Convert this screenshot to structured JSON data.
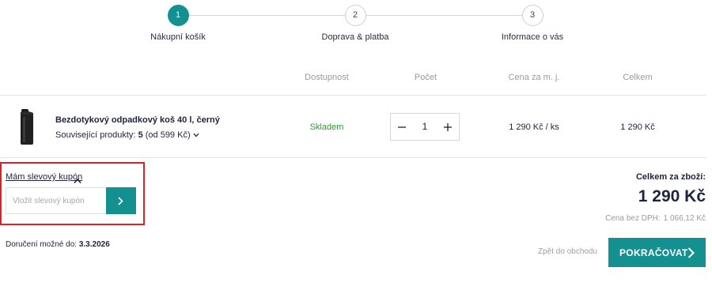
{
  "stepper": {
    "steps": [
      {
        "number": "1",
        "label": "Nákupní košík"
      },
      {
        "number": "2",
        "label": "Doprava & platba"
      },
      {
        "number": "3",
        "label": "Informace o vás"
      }
    ],
    "active_step": 1
  },
  "table": {
    "headers": {
      "availability": "Dostupnost",
      "quantity": "Počet",
      "unit_price": "Cena za m. j.",
      "total": "Celkem"
    }
  },
  "item": {
    "name": "Bezdotykový odpadkový koš 40 l, černý",
    "related_prefix": "Související produkty: ",
    "related_count": "5",
    "related_suffix": " (od 599 Kč)",
    "availability": "Skladem",
    "quantity": "1",
    "unit_price": "1 290 Kč / ks",
    "total": "1 290 Kč"
  },
  "coupon": {
    "link_label": "Mám slevový kupón",
    "placeholder": "Vložit slevový kupón"
  },
  "summary": {
    "label": "Celkem za zboží:",
    "total": "1 290 Kč",
    "net_label": "Cena bez DPH:",
    "net_value": "1 066,12 Kč"
  },
  "delivery": {
    "prefix": "Doručení možné do: ",
    "date": "3.3.2026"
  },
  "actions": {
    "back_label": "Zpět do obchodu",
    "continue_label": "POKRAČOVAT"
  },
  "colors": {
    "accent": "#13908f",
    "highlight_border": "#e11f24",
    "in_stock": "#2f9a2f"
  },
  "icons": {
    "coupon_toggle": "chevron-up-icon",
    "coupon_submit": "chevron-right-icon",
    "continue": "chevron-right-icon",
    "related": "chevron-down-icon"
  }
}
